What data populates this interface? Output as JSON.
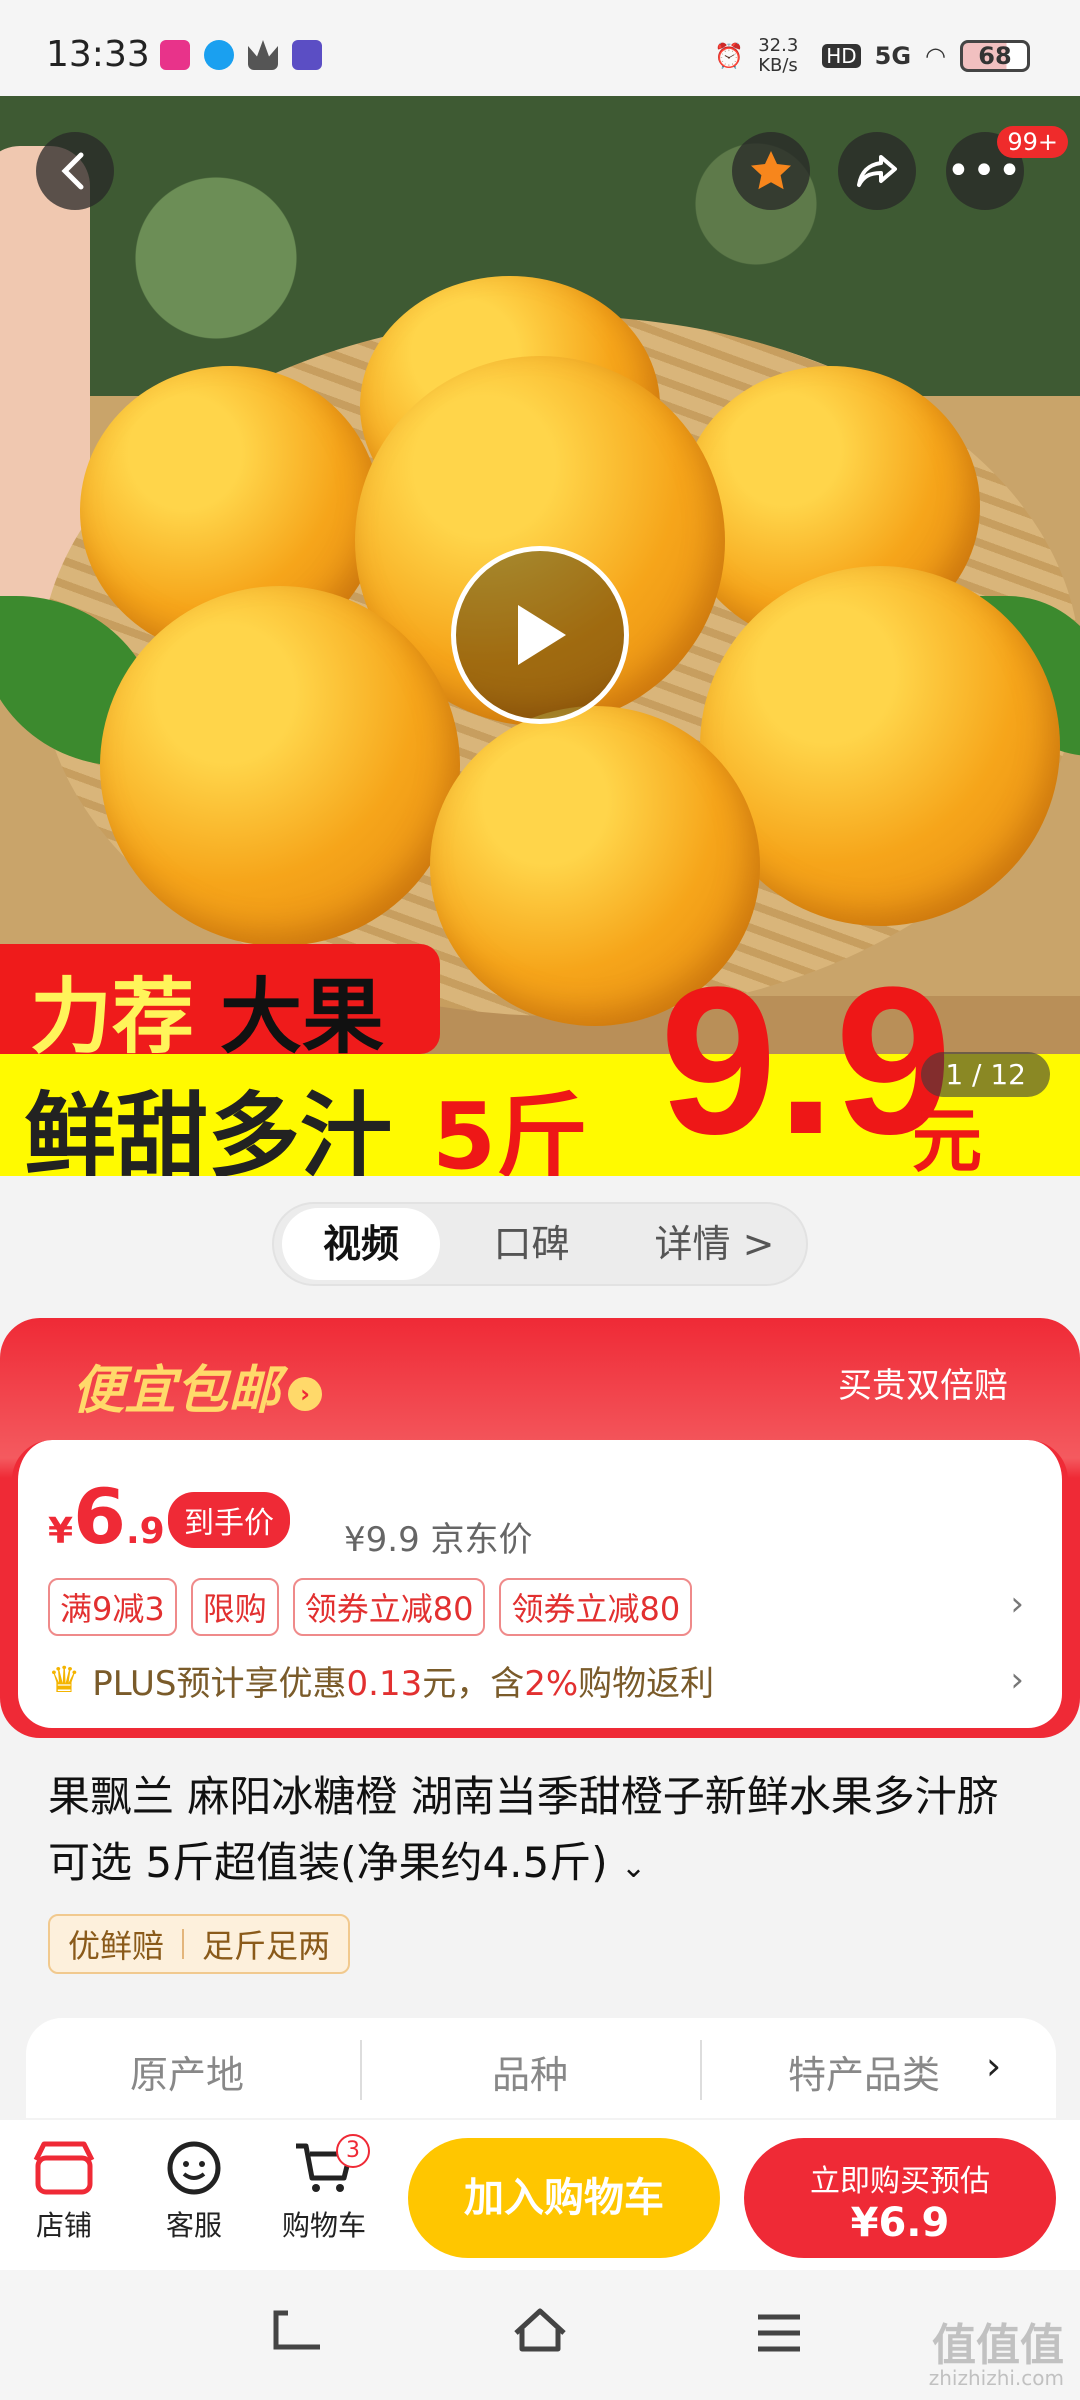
{
  "status": {
    "time": "13:33",
    "net_speed": "32.3 KB/s",
    "hd": "HD",
    "signal": "5G",
    "battery": "68"
  },
  "hero": {
    "badge": "99+",
    "banner_red": [
      "力荐",
      "大果"
    ],
    "banner_yellow_left": "鲜甜多汁",
    "banner_yellow_weight": "5斤",
    "big_price": "9.9",
    "big_price_unit": "元",
    "counter": "1 / 12",
    "icons": [
      "back-icon",
      "star-icon",
      "share-icon",
      "more-icon",
      "play-icon"
    ]
  },
  "tabs": [
    {
      "label": "视频",
      "active": true
    },
    {
      "label": "口碑",
      "active": false
    },
    {
      "label": "详情 >",
      "active": false
    }
  ],
  "promo": {
    "title": "便宜包邮",
    "right_text": "买贵双倍赔",
    "price_currency": "¥",
    "price_int": "6",
    "price_dec": ".9",
    "price_tag": "到手价",
    "jd_price": "¥9.9 京东价",
    "tags": [
      "满9减3",
      "限购",
      "领券立减80",
      "领券立减80"
    ],
    "plus_prefix": "PLUS预计享优惠",
    "plus_amount": "0.13",
    "plus_mid": "元，含",
    "plus_pct": "2%",
    "plus_suffix": "购物返利"
  },
  "product": {
    "title": "果飘兰 麻阳冰糖橙 湖南当季甜橙子新鲜水果多汁脐 可选 5斤超值装(净果约4.5斤)",
    "guarantee_tags": [
      "优鲜赔",
      "足斤足两"
    ]
  },
  "attributes": [
    "原产地",
    "品种",
    "特产品类"
  ],
  "bottom_bar": {
    "shop": "店铺",
    "service": "客服",
    "cart": "购物车",
    "cart_count": "3",
    "add_to_cart": "加入购物车",
    "buy_now_line1": "立即购买预估",
    "buy_now_line2": "¥6.9"
  },
  "watermark": {
    "main": "值值值",
    "site": "zhizhizhi.com"
  },
  "colors": {
    "accent_red": "#ef2a36",
    "cart_yellow": "#ffc600",
    "promo_gold": "#ffd96a"
  }
}
